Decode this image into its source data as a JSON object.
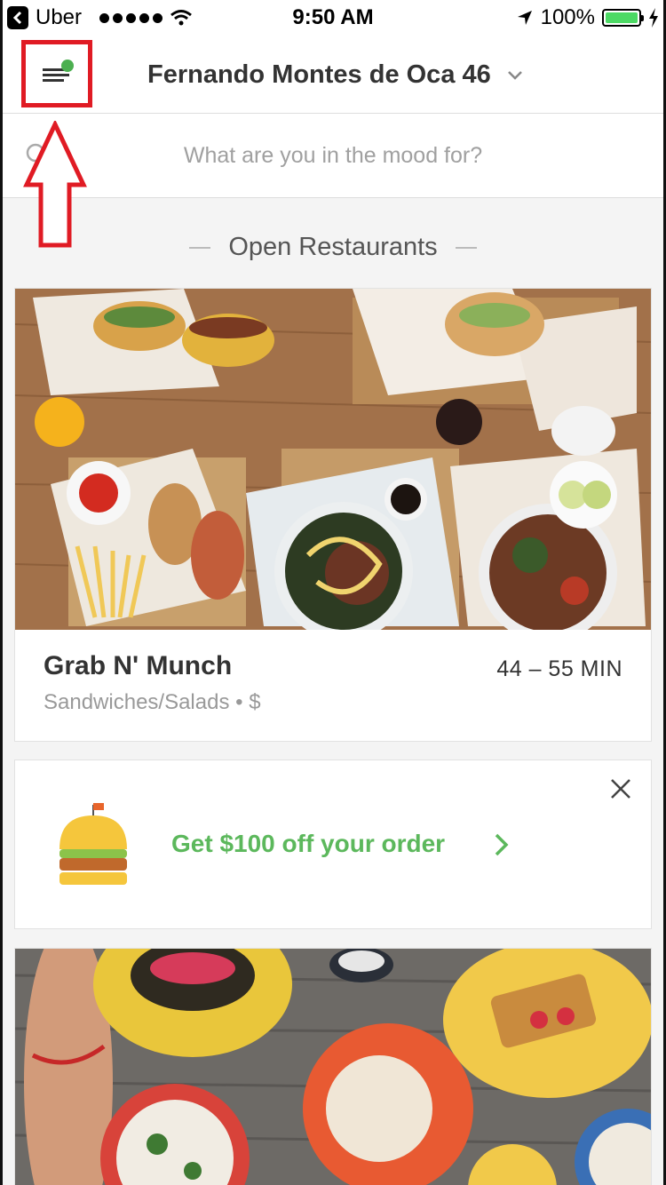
{
  "status_bar": {
    "back_app": "Uber",
    "time": "9:50 AM",
    "battery": "100%"
  },
  "header": {
    "address": "Fernando Montes de Oca 46",
    "menu_icon": "menu-with-notification-icon",
    "dropdown_icon": "chevron-down-icon"
  },
  "search": {
    "placeholder": "What are you in the mood for?"
  },
  "section": {
    "title": "Open Restaurants"
  },
  "restaurants": [
    {
      "name": "Grab N' Munch",
      "eta": "44 – 55 MIN",
      "category": "Sandwiches/Salads • $"
    }
  ],
  "promo": {
    "text": "Get $100 off your order",
    "accent": "#5cb85c"
  },
  "colors": {
    "highlight_box": "#e01b24",
    "notification_dot": "#4caf50"
  }
}
